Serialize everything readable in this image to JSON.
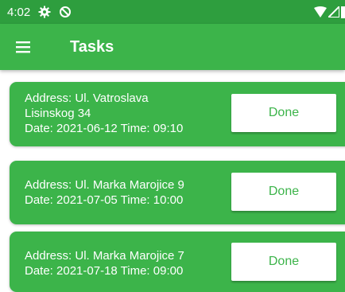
{
  "status_bar": {
    "time": "4:02",
    "icons": [
      "gear-icon",
      "do-not-disturb-icon",
      "wifi-icon",
      "cell-signal-icon",
      "battery-icon"
    ]
  },
  "app_bar": {
    "menu_icon": "hamburger-menu-icon",
    "title": "Tasks"
  },
  "colors": {
    "status_bar": "#2e9e3e",
    "accent": "#3cb44a",
    "button_bg": "#ffffff",
    "button_text": "#3cb44a"
  },
  "tasks": [
    {
      "address_line1": "Address: Ul. Vatroslava",
      "address_line2": "Lisinskog 34",
      "date_line": "Date: 2021-06-12 Time: 09:10",
      "button_label": "Done"
    },
    {
      "address_line1": "Address: Ul. Marka Marojice 9",
      "date_line": "Date: 2021-07-05 Time: 10:00",
      "button_label": "Done"
    },
    {
      "address_line1": "Address: Ul. Marka Marojice 7",
      "date_line": "Date: 2021-07-18 Time: 09:00",
      "button_label": "Done"
    }
  ]
}
